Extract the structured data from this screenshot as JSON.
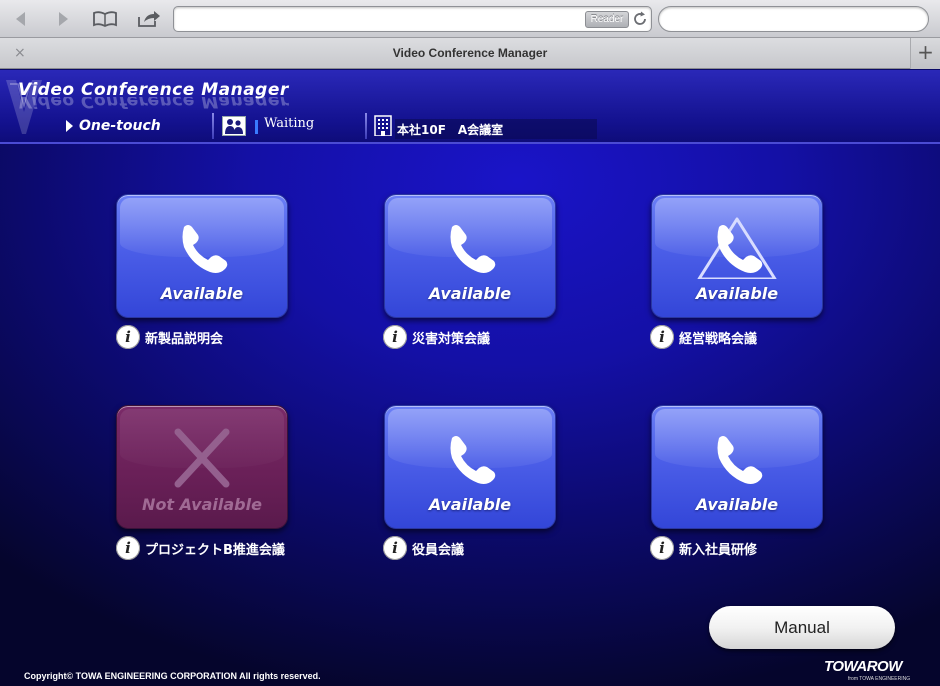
{
  "browser": {
    "tab_title": "Video Conference Manager",
    "reader_label": "Reader",
    "tab_close": "×",
    "tab_add": "+"
  },
  "header": {
    "app_title": "Video Conference Manager",
    "mode_label": "One-touch",
    "status_label": "Waiting",
    "room_label": "本社10F　A会議室"
  },
  "conferences": [
    {
      "name": "新製品説明会",
      "status": "Available",
      "icon": "phone-icon"
    },
    {
      "name": "災害対策会議",
      "status": "Available",
      "icon": "phone-icon"
    },
    {
      "name": "経営戦略会議",
      "status": "Available",
      "icon": "phone-warning-icon"
    },
    {
      "name": "プロジェクトB推進会議",
      "status": "Not Available",
      "icon": "x-icon"
    },
    {
      "name": "役員会議",
      "status": "Available",
      "icon": "phone-icon"
    },
    {
      "name": "新入社員研修",
      "status": "Available",
      "icon": "phone-icon"
    }
  ],
  "footer": {
    "manual_label": "Manual",
    "copyright": "Copyright© TOWA ENGINEERING CORPORATION All rights reserved.",
    "brand": "TOWAROW",
    "brand_sub": "from TOWA ENGINEERING"
  },
  "colors": {
    "background": "#1410a6",
    "tile_available": "#4b5ee8",
    "tile_unavailable": "#6a2058"
  }
}
